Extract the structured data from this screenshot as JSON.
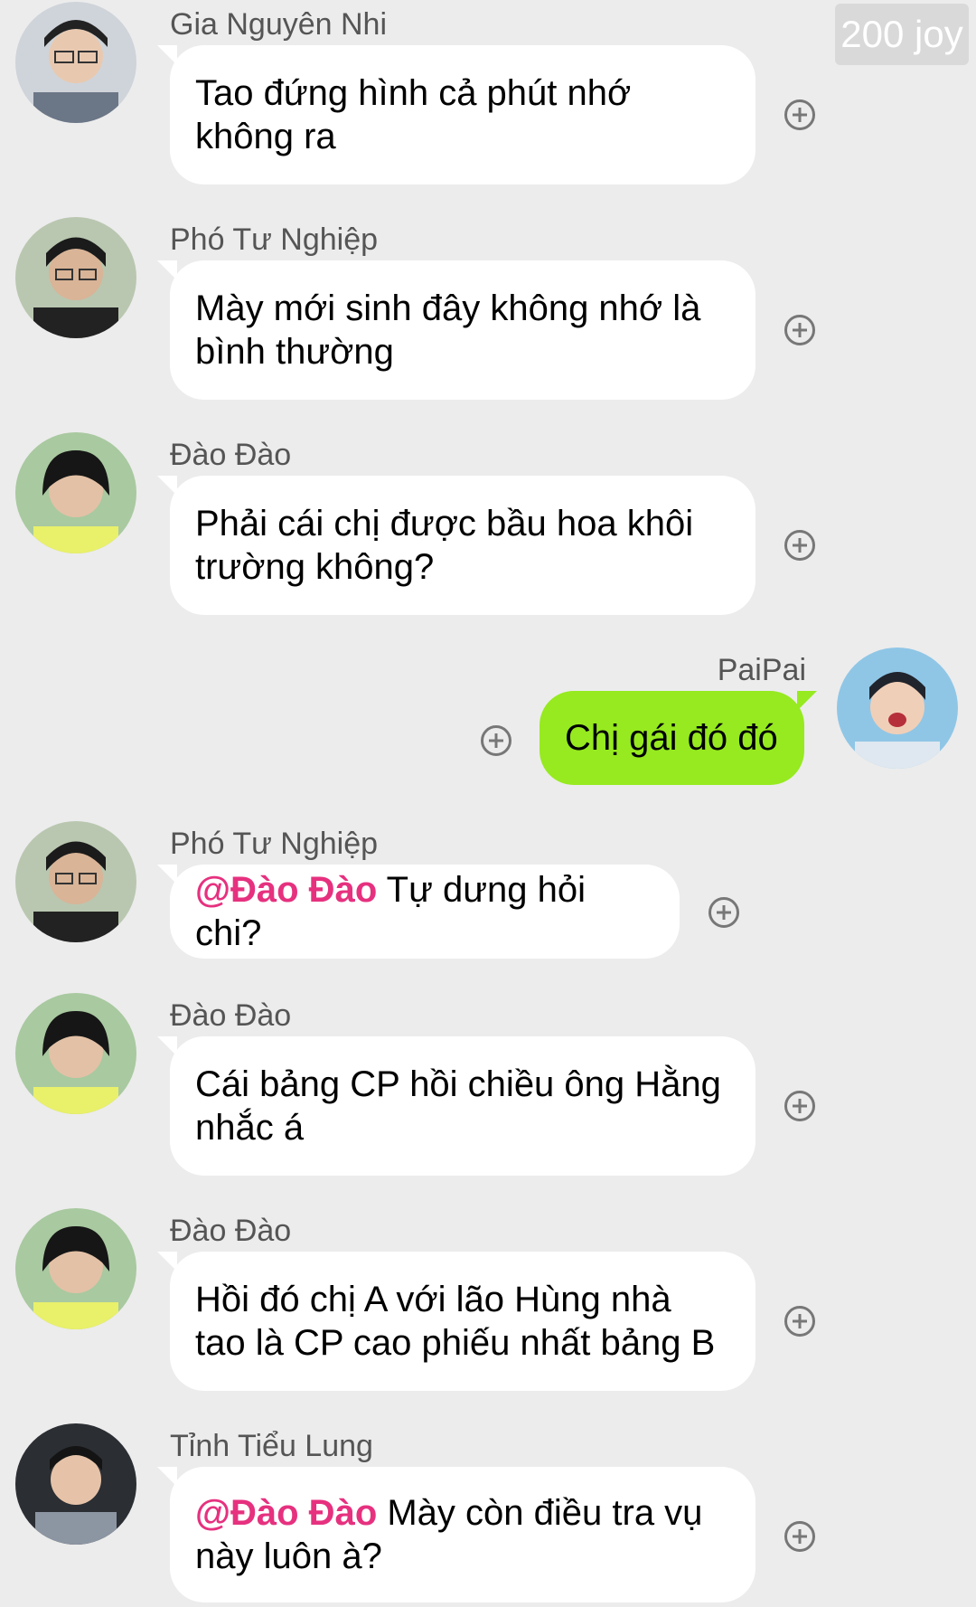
{
  "badge": "200 joy",
  "messages": [
    {
      "sender": "Gia Nguyên Nhi",
      "text_line1": "Tao đứng hình cả phút nhớ",
      "text_line2": "không ra"
    },
    {
      "sender": "Phó Tư Nghiệp",
      "text_line1": "Mày mới sinh đây không nhớ là",
      "text_line2": "bình thường"
    },
    {
      "sender": "Đào Đào",
      "text_line1": "Phải cái chị được bầu hoa khôi",
      "text_line2": "trường không?"
    },
    {
      "sender": "PaiPai",
      "text_line1": "Chị gái đó đó"
    },
    {
      "sender": "Phó Tư Nghiệp",
      "mention": "@Đào Đào",
      "text_line1": " Tự dưng hỏi chi?"
    },
    {
      "sender": "Đào Đào",
      "text_line1": "Cái bảng CP hồi chiều ông Hằng",
      "text_line2": "nhắc á"
    },
    {
      "sender": "Đào Đào",
      "text_line1": "Hồi đó chị A với lão Hùng nhà",
      "text_line2": "tao là CP cao phiếu nhất bảng B"
    },
    {
      "sender": "Tỉnh Tiểu Lung",
      "mention": "@Đào Đào",
      "text_line1": " Mày còn điều tra vụ",
      "text_line2": "này luôn à?"
    }
  ],
  "icons": {
    "add": "plus-circle-icon",
    "avatar": "avatar"
  },
  "colors": {
    "own_bubble": "#96ea1f",
    "mention": "#e6317f",
    "background": "#ececec"
  }
}
